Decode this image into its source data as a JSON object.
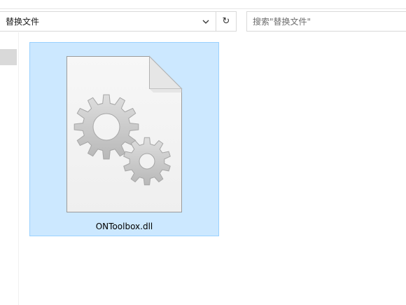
{
  "address_bar": {
    "path": "替换文件",
    "dropdown_icon": "chevron-down-icon",
    "refresh_glyph": "↻"
  },
  "search": {
    "placeholder": "搜索\"替换文件\"",
    "value": ""
  },
  "file": {
    "name": "ONToolbox.dll",
    "icon": "dll-gear-file-icon",
    "selected": true
  },
  "colors": {
    "selection_fill": "#cce8ff",
    "selection_border": "#99d1ff",
    "gear": "#c4c4c4"
  }
}
